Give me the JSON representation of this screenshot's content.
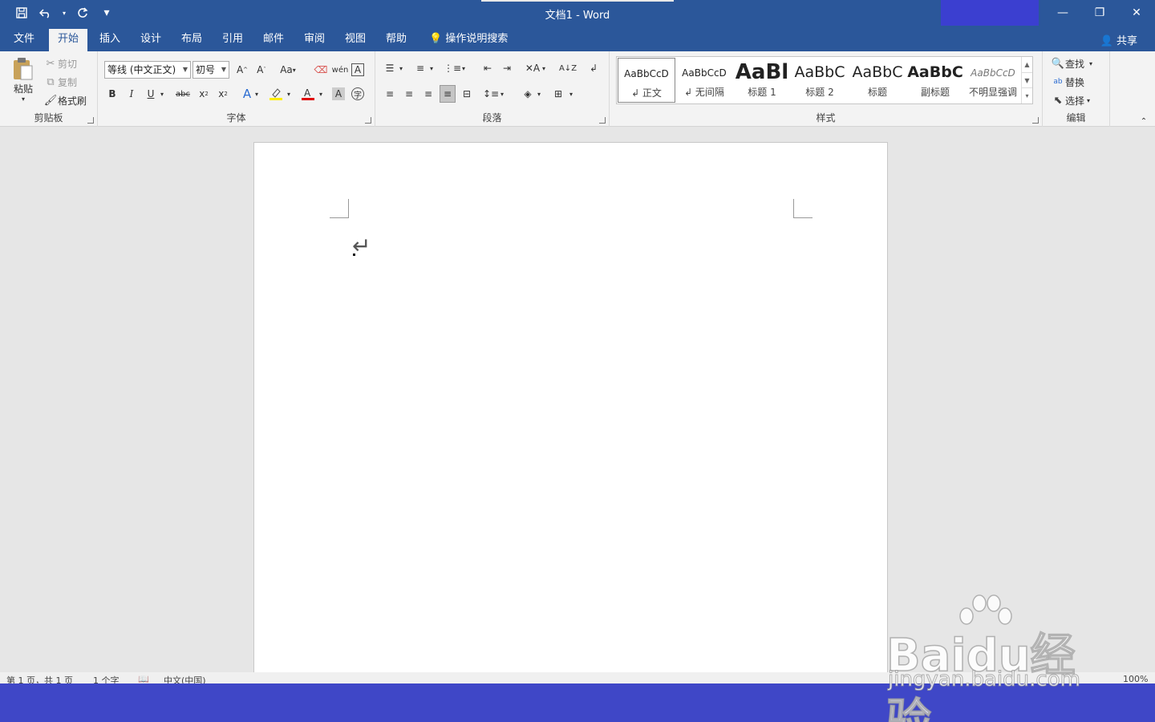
{
  "window": {
    "title": "文档1  -  Word"
  },
  "qat": {
    "save": "save-icon",
    "undo": "undo-icon",
    "redo": "redo-icon",
    "more": "▾"
  },
  "tabs": [
    {
      "label": "文件"
    },
    {
      "label": "开始"
    },
    {
      "label": "插入"
    },
    {
      "label": "设计"
    },
    {
      "label": "布局"
    },
    {
      "label": "引用"
    },
    {
      "label": "邮件"
    },
    {
      "label": "审阅"
    },
    {
      "label": "视图"
    },
    {
      "label": "帮助"
    }
  ],
  "tell_me": "操作说明搜索",
  "share": "共享",
  "clipboard": {
    "label": "剪贴板",
    "paste": "粘贴",
    "cut": "剪切",
    "copy": "复制",
    "format_painter": "格式刷"
  },
  "font": {
    "label": "字体",
    "name": "等线 (中文正文)",
    "size": "初号",
    "aa": "Aa"
  },
  "paragraph": {
    "label": "段落"
  },
  "styles": {
    "label": "样式",
    "items": [
      {
        "preview": "AaBbCcD",
        "name": "↲ 正文"
      },
      {
        "preview": "AaBbCcD",
        "name": "↲ 无间隔"
      },
      {
        "preview": "AaBl",
        "name": "标题 1"
      },
      {
        "preview": "AaBbC",
        "name": "标题 2"
      },
      {
        "preview": "AaBbC",
        "name": "标题"
      },
      {
        "preview": "AaBbC",
        "name": "副标题"
      },
      {
        "preview": "AaBbCcD",
        "name": "不明显强调"
      }
    ]
  },
  "editing": {
    "label": "编辑",
    "find": "查找",
    "replace": "替换",
    "select": "选择"
  },
  "status": {
    "page": "第 1 页，共 1 页",
    "words": "1 个字",
    "lang": "中文(中国)",
    "zoom": "100%"
  },
  "watermark": {
    "brand": "Baidu经验",
    "url": "jingyan.baidu.com"
  }
}
